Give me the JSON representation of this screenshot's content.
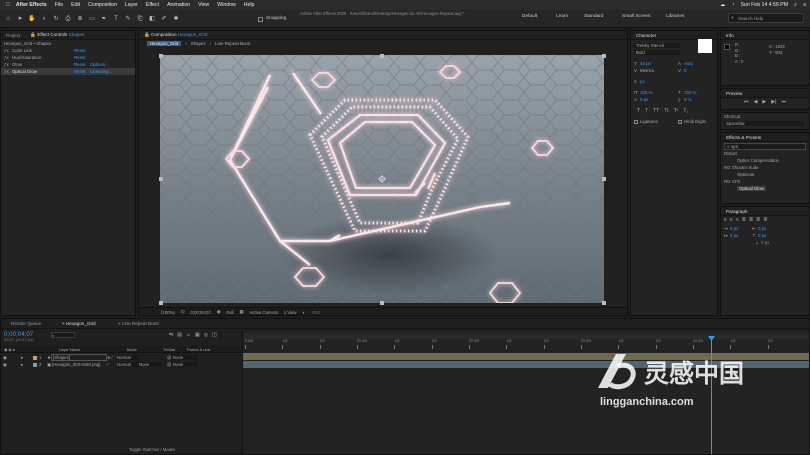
{
  "menubar": {
    "app_name": "After Effects",
    "items": [
      "File",
      "Edit",
      "Composition",
      "Layer",
      "Effect",
      "Animation",
      "View",
      "Window",
      "Help"
    ],
    "clock": "Sun Feb 14  4:56 PM"
  },
  "toolbar": {
    "snapping_label": "Snapping",
    "window_title": "Adobe After Effects 2020 - /Users/brand/Desktop/Hexagon for AE/Hexagon Repeat.aep *",
    "workspaces": [
      "Default",
      "Learn",
      "Standard",
      "Small Screen",
      "Libraries"
    ],
    "search_placeholder": "Search Help"
  },
  "project_panel": {
    "tab_project": "Project",
    "tab_effect_controls": "Effect Controls",
    "effect_controls_target": "Shapes",
    "header": "Hexagon_Grid • Shapes",
    "effects": [
      {
        "name": "Color Link",
        "reset": "Reset",
        "extra": ""
      },
      {
        "name": "Hue/Saturation",
        "reset": "Reset",
        "extra": ""
      },
      {
        "name": "Glow",
        "reset": "Reset",
        "extra": "Options..."
      },
      {
        "name": "Optical Glow",
        "reset": "Reset",
        "extra": "Licensing..."
      }
    ]
  },
  "comp_panel": {
    "tab_label": "Composition",
    "comp_name": "Hexagon_Grid",
    "breadcrumbs": [
      "Hexagon_Grid",
      "Shapes",
      "Line Repeat Burst"
    ],
    "footer": {
      "zoom": "(100%)",
      "timecode": "0;00;04;07",
      "resolution": "Full",
      "camera": "Active Camera",
      "views": "1 View",
      "exposure": "+0.0"
    }
  },
  "character_panel": {
    "title": "Character",
    "font": "Trebby Stencil",
    "style": "Bold",
    "size": "40 px",
    "leading": "Auto",
    "tracking": "Metrics",
    "kerning": "0",
    "stroke": "px",
    "scale_v": "100 %",
    "scale_h": "100 %",
    "baseline": "0 px",
    "tsume": "0 %",
    "ligatures": "Ligatures",
    "hindi_digits": "Hindi Digits"
  },
  "info_panel": {
    "title": "Info",
    "r": "R :",
    "g": "G :",
    "b": "B :",
    "a": "A : 0",
    "x": "X : 1829",
    "y": "Y : 504"
  },
  "preview_panel": {
    "title": "Preview"
  },
  "shortcut_panel": {
    "title": "Shortcut",
    "value": "Spacebar"
  },
  "effects_presets_panel": {
    "title": "Effects & Presets",
    "search_value": "opti",
    "tree": [
      {
        "label": "Distort",
        "indent": 0
      },
      {
        "label": "Optics Compensation",
        "indent": 1
      },
      {
        "label": "RG Shooter Suite",
        "indent": 0
      },
      {
        "label": "Optiscan",
        "indent": 1
      },
      {
        "label": "RG VFX",
        "indent": 0
      },
      {
        "label": "Optical Glow",
        "indent": 1
      }
    ]
  },
  "paragraph_panel": {
    "title": "Paragraph",
    "indent_left": "0 px",
    "indent_right": "0 px",
    "indent_first": "0 px",
    "space_before": "0 px",
    "space_after": "0 px"
  },
  "timeline": {
    "tabs": [
      "Render Queue",
      "Hexagon_Grid",
      "Line Repeat Burst"
    ],
    "timecode": "0;00;04;07",
    "fps": "00127 (29.97 fps)",
    "columns": {
      "source": "Layer Name",
      "mode": "Mode",
      "trkmat": "TrkMat",
      "parent": "Parent & Link"
    },
    "layers": [
      {
        "num": "1",
        "name": "[Shapes]",
        "mode": "Normal",
        "trkmat": "",
        "parent": "None",
        "color": "#b8a96a"
      },
      {
        "num": "2",
        "name": "[Hexagon_000-0150.png]",
        "mode": "Normal",
        "trkmat": "None",
        "parent": "None",
        "color": "#7b9ea8"
      }
    ],
    "ruler_ticks": [
      "0:00f",
      "10f",
      "20f",
      "01:00f",
      "10f",
      "20f",
      "02:00f",
      "10f",
      "20f",
      "03:00f",
      "10f",
      "20f",
      "04:00f",
      "10f",
      "20f"
    ],
    "footer": "Toggle Switches / Modes"
  },
  "watermark": {
    "brand": "灵感中国",
    "url": "lingganchina.com"
  }
}
